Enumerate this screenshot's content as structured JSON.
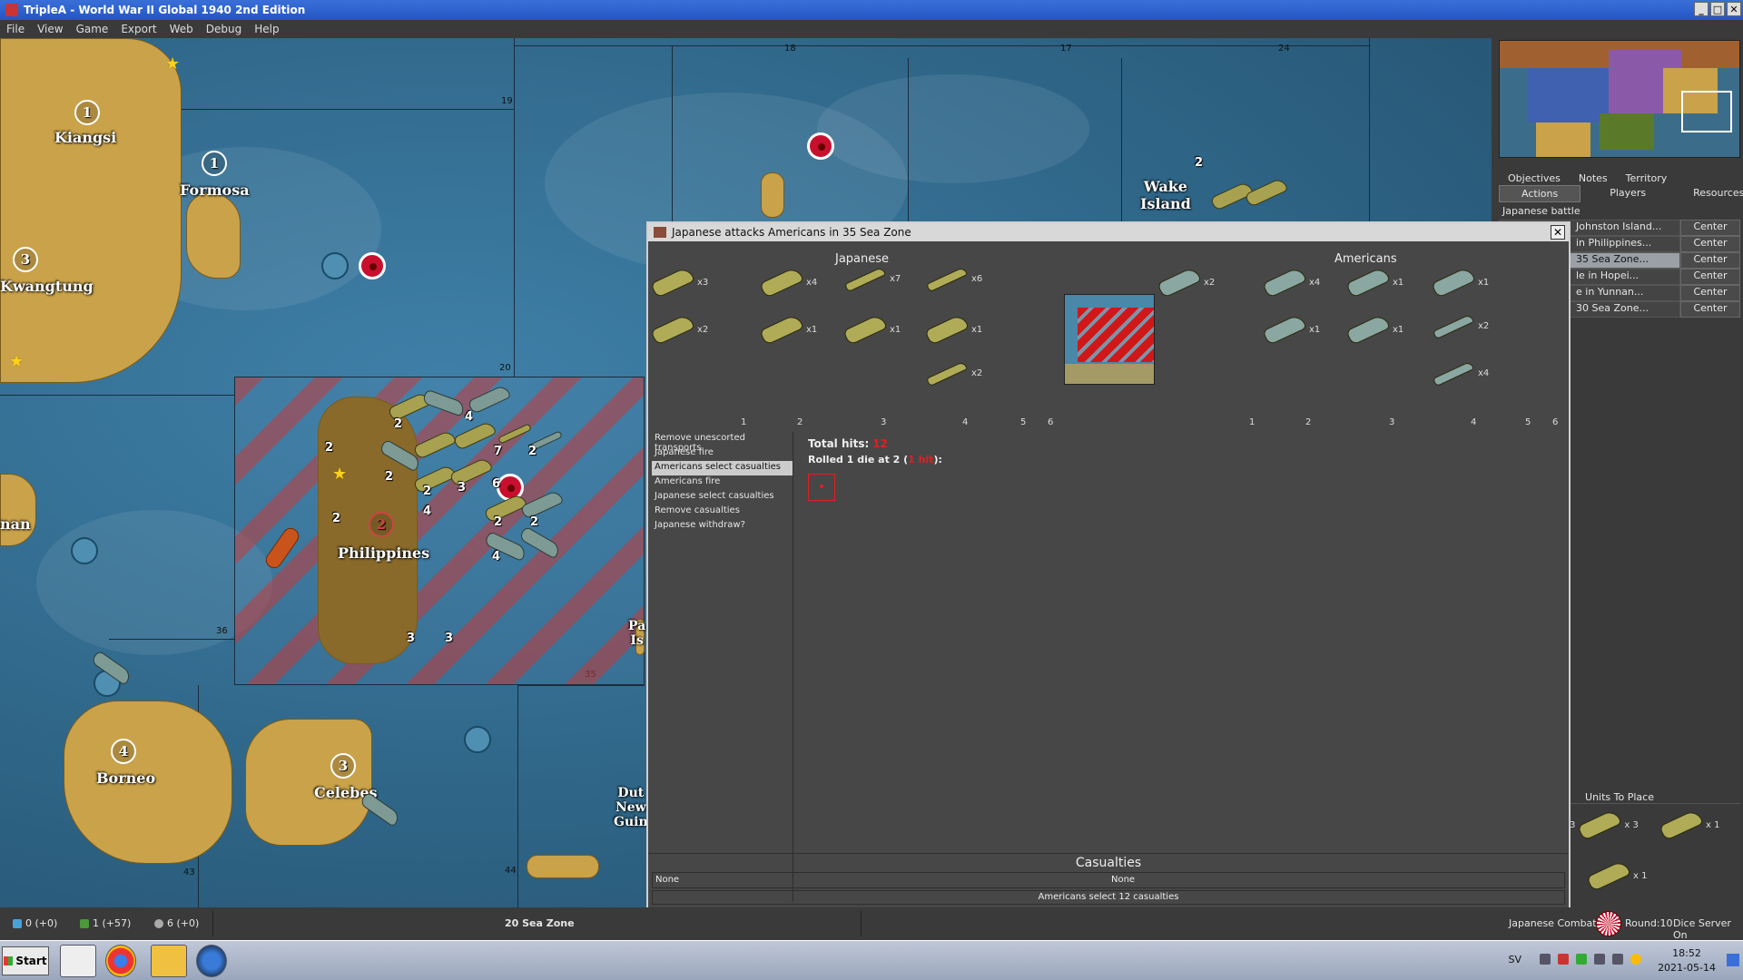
{
  "window": {
    "title": "TripleA - World War II Global 1940 2nd Edition",
    "controls": [
      "_",
      "□",
      "✕"
    ]
  },
  "menu": [
    "File",
    "View",
    "Game",
    "Export",
    "Web",
    "Debug",
    "Help"
  ],
  "map": {
    "territories": [
      {
        "name": "Kiangsi",
        "ipc": "1"
      },
      {
        "name": "Formosa",
        "ipc": "1"
      },
      {
        "name": "Kwangtung",
        "ipc": "3"
      },
      {
        "name": "nan",
        "ipc": ""
      },
      {
        "name": "Philippines",
        "ipc": "2"
      },
      {
        "name": "Borneo",
        "ipc": "4"
      },
      {
        "name": "Celebes",
        "ipc": "3"
      },
      {
        "name": "Wake\nIsland",
        "ipc": ""
      },
      {
        "name": "Pa\nIs",
        "ipc": ""
      },
      {
        "name": "Dut\nNew\nGuin",
        "ipc": ""
      }
    ],
    "zone_numbers": [
      "18",
      "17",
      "24",
      "19",
      "20",
      "36",
      "35",
      "43",
      "44"
    ],
    "stack_counts": [
      "2",
      "4",
      "2",
      "2",
      "7",
      "2",
      "2",
      "4",
      "3",
      "6",
      "2",
      "2",
      "2",
      "4",
      "3",
      "3",
      "2"
    ]
  },
  "sidepanel": {
    "tabs_top": [
      "Objectives",
      "Notes",
      "Territory"
    ],
    "tabs_bottom": [
      "Actions",
      "Players",
      "Resources"
    ],
    "active_tab": "Actions",
    "section_label": "Japanese battle",
    "battles": [
      {
        "name": "Johnston Island...",
        "center": "Center"
      },
      {
        "name": "in Philippines...",
        "center": "Center"
      },
      {
        "name": "35 Sea Zone...",
        "center": "Center"
      },
      {
        "name": "le in Hopei...",
        "center": "Center"
      },
      {
        "name": "e in Yunnan...",
        "center": "Center"
      },
      {
        "name": "30 Sea Zone...",
        "center": "Center"
      }
    ],
    "units_to_place_title": "Units To Place",
    "units_to_place": [
      {
        "count": "3"
      },
      {
        "count": "x 3"
      },
      {
        "count": "x 1"
      },
      {
        "count": "x 1"
      }
    ]
  },
  "dialog": {
    "title": "Japanese attacks Americans in 35 Sea Zone",
    "close": "✕",
    "attacker": "Japanese",
    "defender": "Americans",
    "attacker_units": [
      {
        "count": "x3",
        "kind": "ship"
      },
      {
        "count": "x4",
        "kind": "ship"
      },
      {
        "count": "x7",
        "kind": "air"
      },
      {
        "count": "x6",
        "kind": "air"
      },
      {
        "count": "x2",
        "kind": "ship"
      },
      {
        "count": "x1",
        "kind": "ship"
      },
      {
        "count": "x1",
        "kind": "ship"
      },
      {
        "count": "x1",
        "kind": "ship"
      },
      {
        "count": "x2",
        "kind": "air"
      }
    ],
    "defender_units": [
      {
        "count": "x2",
        "kind": "ship"
      },
      {
        "count": "x4",
        "kind": "ship"
      },
      {
        "count": "x1",
        "kind": "ship"
      },
      {
        "count": "x1",
        "kind": "ship"
      },
      {
        "count": "x1",
        "kind": "ship"
      },
      {
        "count": "x1",
        "kind": "ship"
      },
      {
        "count": "x2",
        "kind": "air"
      },
      {
        "count": "x4",
        "kind": "air"
      }
    ],
    "attacker_dice_axis": [
      "1",
      "2",
      "3",
      "4",
      "5",
      "6"
    ],
    "defender_dice_axis": [
      "1",
      "2",
      "3",
      "4",
      "5",
      "6"
    ],
    "steps": [
      "Remove unescorted transports",
      "Japanese fire",
      "Americans select casualties",
      "Americans fire",
      "Japanese select casualties",
      "Remove casualties",
      "Japanese withdraw?"
    ],
    "current_step": 2,
    "total_hits_label": "Total hits:",
    "total_hits": "12",
    "rolled_prefix": "Rolled 1 die at 2 (",
    "rolled_hits": "1 hit",
    "rolled_suffix": "):",
    "die_value": "•",
    "casualties_title": "Casualties",
    "casualties_attacker": "None",
    "casualties_defender": "None",
    "status": "Americans select 12 casualties"
  },
  "statusbar": {
    "res1": "0 (+0)",
    "res2": "1 (+57)",
    "res3": "6 (+0)",
    "zone": "20 Sea Zone",
    "phase": "Japanese Combat",
    "round": "Round:10",
    "dice": "Dice Server On"
  },
  "taskbar": {
    "start": "Start",
    "lang": "SV",
    "time": "18:52",
    "date": "2021-05-14"
  }
}
